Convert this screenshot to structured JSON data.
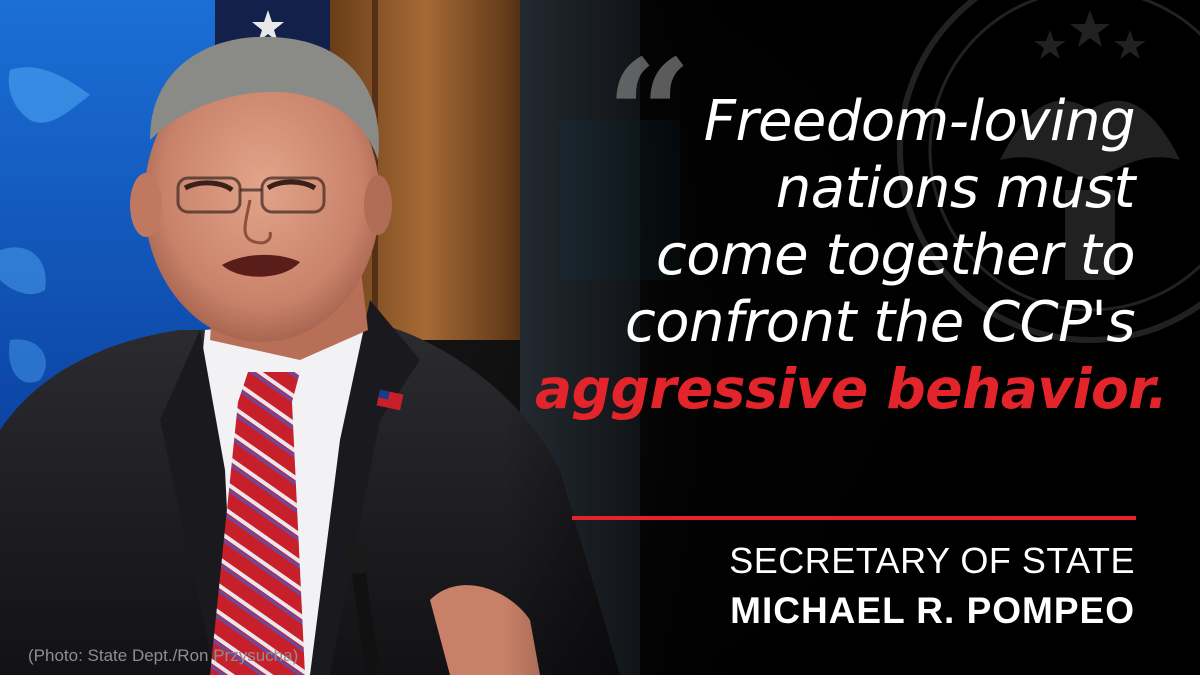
{
  "quote": {
    "lines": [
      "Freedom-loving",
      "nations must",
      "come together to",
      "confront the CCP's"
    ],
    "emphasis": "aggressive behavior."
  },
  "attribution": {
    "title": "SECRETARY OF STATE",
    "name": "MICHAEL R. POMPEO"
  },
  "credit": "(Photo: State Dept./Ron Przysucha)",
  "colors": {
    "accent": "#e3242b",
    "text": "#ffffff",
    "background": "#050505"
  }
}
